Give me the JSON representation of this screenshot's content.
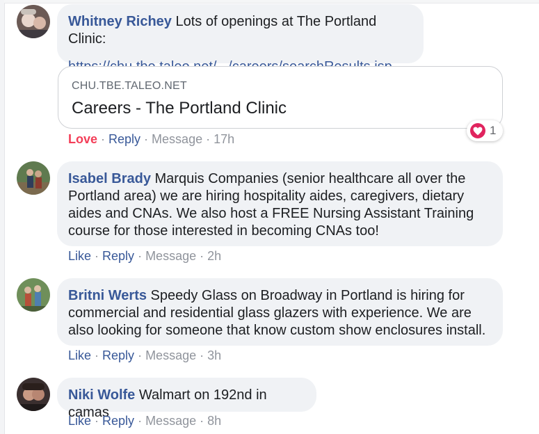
{
  "comments": [
    {
      "author": "Whitney Richey",
      "text": "Lots of openings at The Portland Clinic:",
      "link": "https://chu.tbe.taleo.net/.../careers/searchResults.jsp...",
      "preview": {
        "domain": "CHU.TBE.TALEO.NET",
        "title": "Careers - The Portland Clinic"
      },
      "reaction_count": "1",
      "reaction_icon": "heart-icon",
      "actions": {
        "react": "Love",
        "reply": "Reply",
        "message": "Message",
        "time": "17h"
      }
    },
    {
      "author": "Isabel Brady",
      "text": "Marquis Companies (senior healthcare all over the Portland area) we are hiring hospitality aides, caregivers, dietary aides and CNAs. We also host a FREE Nursing Assistant Training course for those interested in becoming CNAs too!",
      "actions": {
        "react": "Like",
        "reply": "Reply",
        "message": "Message",
        "time": "2h"
      }
    },
    {
      "author": "Britni Werts",
      "text": "Speedy Glass on Broadway in Portland is hiring for commercial and residential glass glazers with experience. We are also looking for someone that know custom show enclosures install.",
      "actions": {
        "react": "Like",
        "reply": "Reply",
        "message": "Message",
        "time": "3h"
      }
    },
    {
      "author": "Niki Wolfe",
      "text": "Walmart on 192nd in camas",
      "actions": {
        "react": "Like",
        "reply": "Reply",
        "message": "Message",
        "time": "8h"
      }
    }
  ],
  "separator": " · ",
  "colors": {
    "author": "#385898",
    "love": "#f33e58",
    "bubble": "#f0f2f5",
    "muted": "#90949c"
  }
}
